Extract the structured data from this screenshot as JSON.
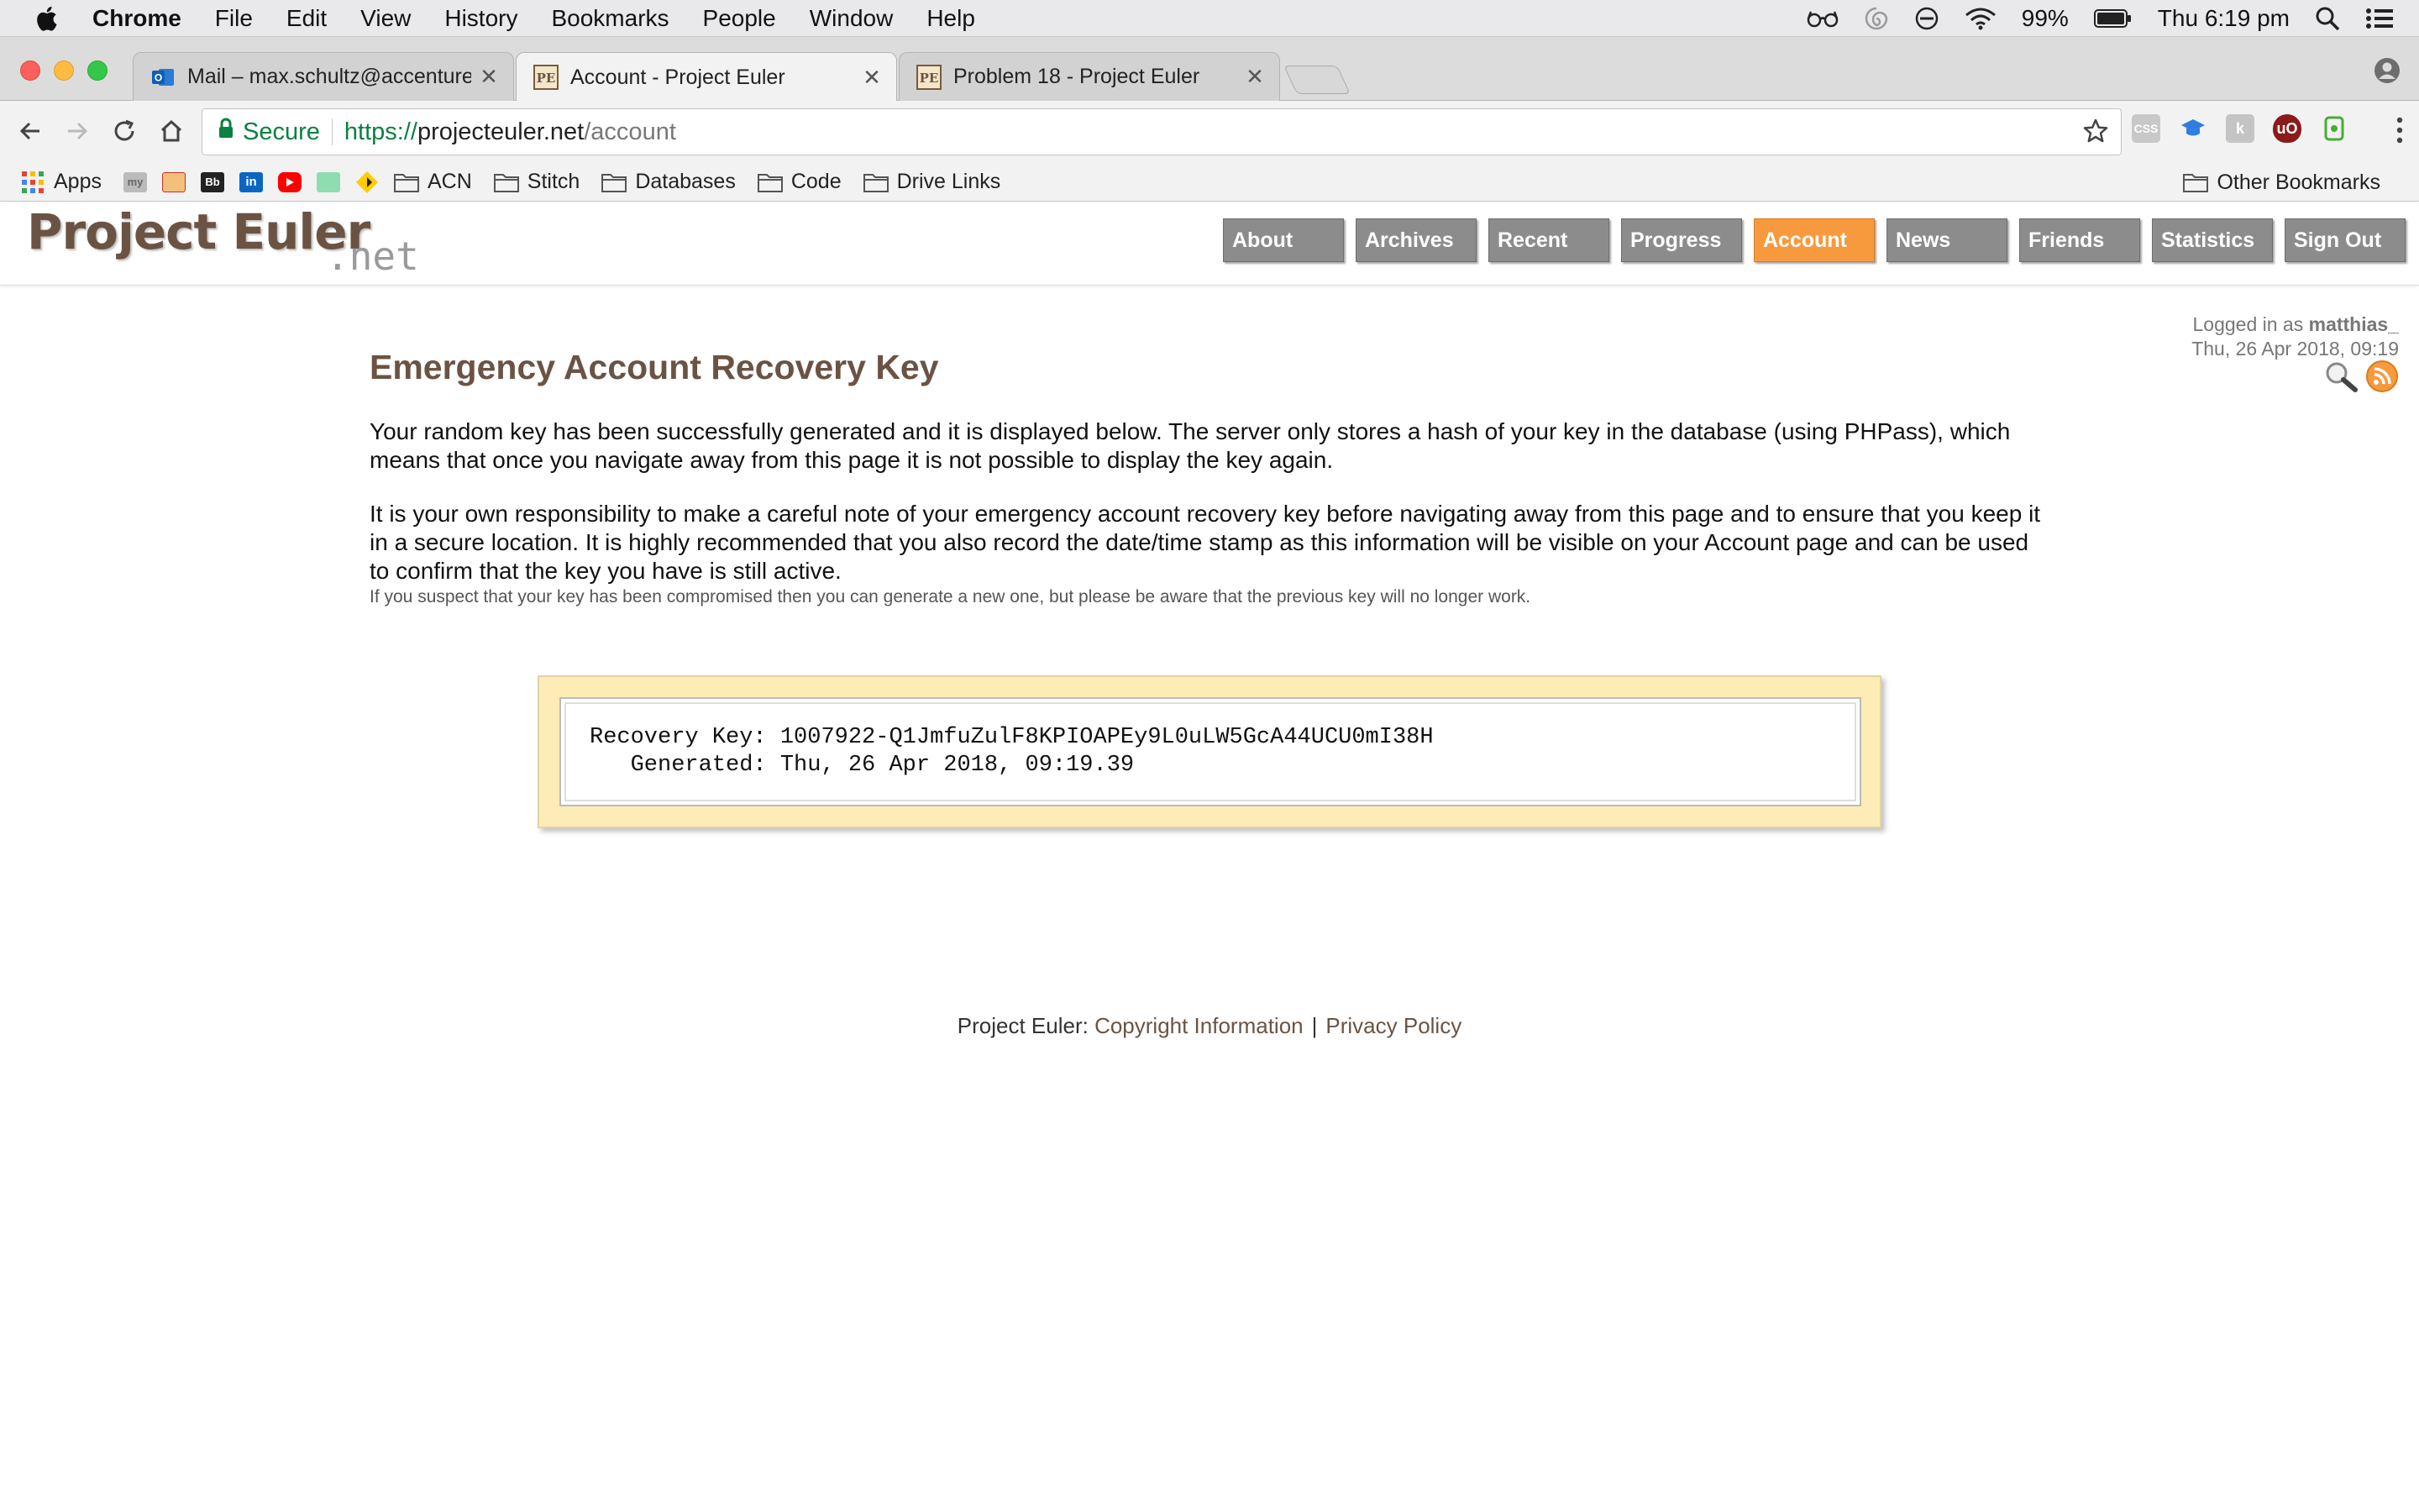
{
  "menubar": {
    "app": "Chrome",
    "items": [
      "File",
      "Edit",
      "View",
      "History",
      "Bookmarks",
      "People",
      "Window",
      "Help"
    ],
    "battery": "99%",
    "clock": "Thu 6:19 pm"
  },
  "tabs": [
    {
      "title": "Mail – max.schultz@accenture",
      "favicon": "outlook-icon",
      "active": false
    },
    {
      "title": "Account - Project Euler",
      "favicon": "project-euler-icon",
      "active": true
    },
    {
      "title": "Problem 18 - Project Euler",
      "favicon": "project-euler-icon",
      "active": false
    }
  ],
  "omnibox": {
    "secure_label": "Secure",
    "scheme": "https://",
    "host": "projecteuler.net",
    "path": "/account"
  },
  "bookmarks": {
    "apps": "Apps",
    "folders": [
      "ACN",
      "Stitch",
      "Databases",
      "Code",
      "Drive Links"
    ],
    "other": "Other Bookmarks"
  },
  "logo": {
    "main": "Project Euler",
    "suffix": ".net"
  },
  "nav": [
    "About",
    "Archives",
    "Recent",
    "Progress",
    "Account",
    "News",
    "Friends",
    "Statistics",
    "Sign Out"
  ],
  "nav_active": "Account",
  "info": {
    "logged_prefix": "Logged in as ",
    "username": "matthias_",
    "datetime": "Thu, 26 Apr 2018, 09:19"
  },
  "content": {
    "heading": "Emergency Account Recovery Key",
    "para1": "Your random key has been successfully generated and it is displayed below. The server only stores a hash of your key in the database (using PHPass), which means that once you navigate away from this page it is not possible to display the key again.",
    "para2": "It is your own responsibility to make a careful note of your emergency account recovery key before navigating away from this page and to ensure that you keep it in a secure location. It is highly recommended that you also record the date/time stamp as this information will be visible on your Account page and can be used to confirm that the key you have is still active.",
    "note": "If you suspect that your key has been compromised then you can generate a new one, but please be aware that the previous key will no longer work."
  },
  "recovery": {
    "key_label": "Recovery Key:",
    "key_value": "1007922-Q1JmfuZulF8KPIOAPEy9L0uLW5GcA44UCU0mI38H",
    "generated_label": "Generated:",
    "generated_value": "Thu, 26 Apr 2018, 09:19.39"
  },
  "footer": {
    "prefix": "Project Euler: ",
    "copyright": "Copyright Information",
    "separator": "|",
    "privacy": "Privacy Policy"
  },
  "colors": {
    "brand_brown": "#6b5344",
    "nav_grey": "#8c8c8c",
    "nav_active": "#f79a3e",
    "keybox_bg": "#fdecb6",
    "secure_green": "#0b8043"
  }
}
